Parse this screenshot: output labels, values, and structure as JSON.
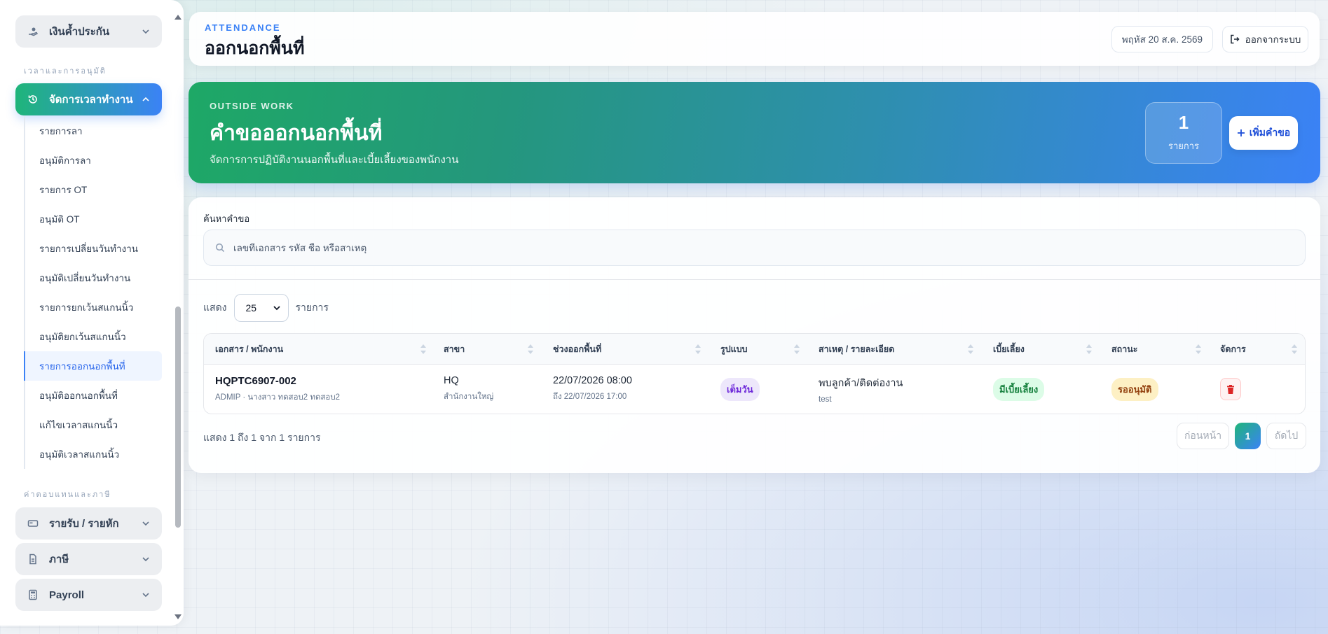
{
  "sidebar": {
    "top_group": "เงินค้ำประกัน",
    "section_time": "เวลาและการอนุมัติ",
    "active_group": "จัดการเวลาทำงาน",
    "sub_items": [
      "รายการลา",
      "อนุมัติการลา",
      "รายการ OT",
      "อนุมัติ OT",
      "รายการเปลี่ยนวันทำงาน",
      "อนุมัติเปลี่ยนวันทำงาน",
      "รายการยกเว้นสแกนนิ้ว",
      "อนุมัติยกเว้นสแกนนิ้ว",
      "รายการออกนอกพื้นที่",
      "อนุมัติออกนอกพื้นที่",
      "แก้ไขเวลาสแกนนิ้ว",
      "อนุมัติเวลาสแกนนิ้ว"
    ],
    "active_sub_index": 8,
    "section_pay": "ค่าตอบแทนและภาษี",
    "bottom_groups": [
      "รายรับ / รายหัก",
      "ภาษี",
      "Payroll"
    ]
  },
  "header": {
    "eyebrow": "ATTENDANCE",
    "title": "ออกนอกพื้นที่",
    "date": "พฤหัส 20 ส.ค. 2569",
    "logout": "ออกจากระบบ"
  },
  "hero": {
    "eyebrow": "OUTSIDE WORK",
    "title": "คำขอออกนอกพื้นที่",
    "subtitle": "จัดการการปฏิบัติงานนอกพื้นที่และเบี้ยเลี้ยงของพนักงาน",
    "count": "1",
    "count_label": "รายการ",
    "add_label": "เพิ่มคำขอ"
  },
  "search": {
    "label": "ค้นหาคำขอ",
    "placeholder": "เลขที่เอกสาร รหัส ชื่อ หรือสาเหตุ"
  },
  "list": {
    "show_label": "แสดง",
    "page_size": "25",
    "items_label": "รายการ"
  },
  "table": {
    "columns": [
      "เอกสาร / พนักงาน",
      "สาขา",
      "ช่วงออกพื้นที่",
      "รูปแบบ",
      "สาเหตุ / รายละเอียด",
      "เบี้ยเลี้ยง",
      "สถานะ",
      "จัดการ"
    ],
    "rows": [
      {
        "doc_no": "HQPTC6907-002",
        "employee": "ADMIP · นางสาว ทดสอบ2 ทดสอบ2",
        "branch": "HQ",
        "branch_name": "สำนักงานใหญ่",
        "start": "22/07/2026 08:00",
        "end": "ถึง 22/07/2026 17:00",
        "type": "เต็มวัน",
        "reason": "พบลูกค้า/ติดต่องาน",
        "detail": "test",
        "allowance": "มีเบี้ยเลี้ยง",
        "status": "รออนุมัติ"
      }
    ]
  },
  "footer": {
    "info": "แสดง 1 ถึง 1 จาก 1 รายการ",
    "prev": "ก่อนหน้า",
    "current_page": "1",
    "next": "ถัดไป"
  },
  "colors": {
    "accent_green": "#1fb57a",
    "accent_blue": "#3b82f6",
    "danger": "#dc2626"
  }
}
